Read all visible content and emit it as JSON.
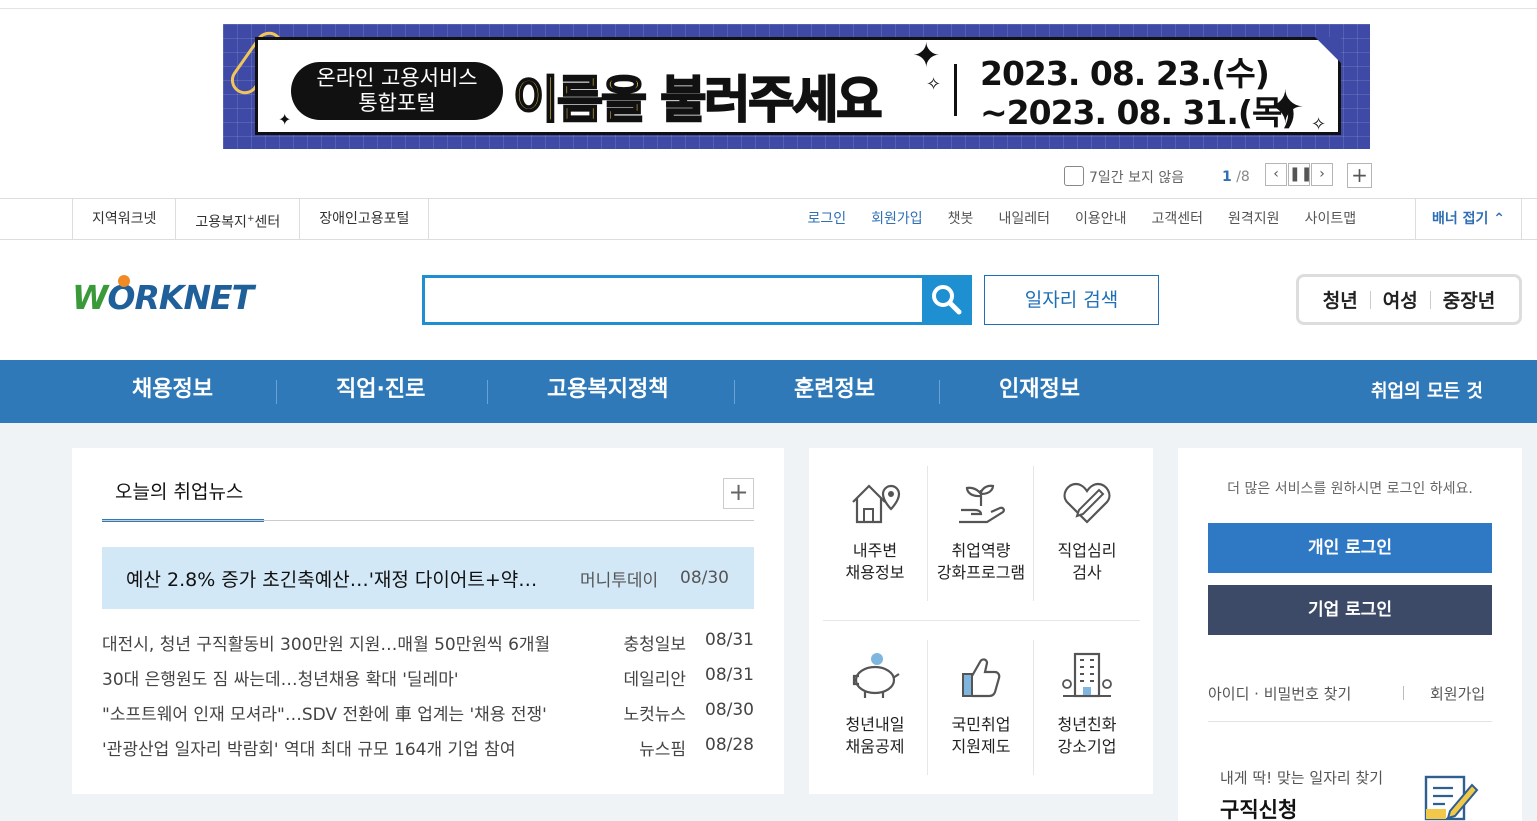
{
  "banner": {
    "pill_line1": "온라인 고용서비스",
    "pill_line2": "통합포털",
    "title_highlight": "이름을",
    "title_rest": " 불러주세요",
    "date_from": "2023. 08. 23.(수)",
    "date_to": "~2023. 08.  31.(목)",
    "dismiss_label": "7일간 보지 않음",
    "counter_current": "1",
    "counter_total": "/8"
  },
  "util_left": [
    "지역워크넷",
    "고용복지",
    "센터",
    "장애인고용포털"
  ],
  "util_left_sup": "+",
  "util_right": [
    "로그인",
    "회원가입",
    "챗봇",
    "내일레터",
    "이용안내",
    "고객센터",
    "원격지원",
    "사이트맵"
  ],
  "fold_banner": "배너 접기",
  "logo": {
    "text": "ORKNET",
    "w": "W"
  },
  "search": {
    "value": "",
    "button_label": "일자리 검색"
  },
  "target_groups": [
    "청년",
    "여성",
    "중장년"
  ],
  "gnb": [
    "채용정보",
    "직업·진로",
    "고용복지정책",
    "훈련정보",
    "인재정보"
  ],
  "gnb_all": "취업의 모든 것",
  "news": {
    "tab": "오늘의 취업뉴스",
    "headline": {
      "title": "예산 2.8% 증가 초긴축예산…'재정 다이어트+약…",
      "source": "머니투데이",
      "date": "08/30"
    },
    "items": [
      {
        "title": "대전시, 청년 구직활동비 300만원 지원…매월 50만원씩 6개월",
        "source": "충청일보",
        "date": "08/31"
      },
      {
        "title": "30대 은행원도 짐 싸는데…청년채용 확대 '딜레마'",
        "source": "데일리안",
        "date": "08/31"
      },
      {
        "title": "\"소프트웨어 인재 모셔라\"…SDV 전환에 車 업계는 '채용 전쟁'",
        "source": "노컷뉴스",
        "date": "08/30"
      },
      {
        "title": "'관광산업 일자리 박람회' 역대 최대 규모 164개 기업 참여",
        "source": "뉴스핌",
        "date": "08/28"
      }
    ]
  },
  "services": [
    {
      "line1": "내주변",
      "line2": "채용정보",
      "icon": "house-location-icon"
    },
    {
      "line1": "취업역량",
      "line2": "강화프로그램",
      "icon": "sprout-hand-icon"
    },
    {
      "line1": "직업심리",
      "line2": "검사",
      "icon": "heart-pen-icon"
    },
    {
      "line1": "청년내일",
      "line2": "채움공제",
      "icon": "piggy-bank-icon"
    },
    {
      "line1": "국민취업",
      "line2": "지원제도",
      "icon": "thumbs-up-icon"
    },
    {
      "line1": "청년친화",
      "line2": "강소기업",
      "icon": "building-icon"
    }
  ],
  "login": {
    "hint": "더 많은 서비스를 원하시면 로그인 하세요.",
    "personal": "개인 로그인",
    "company": "기업 로그인",
    "find": "아이디 · 비밀번호 찾기",
    "join": "회원가입",
    "apply_small": "내게 딱! 맞는 일자리 찾기",
    "apply_big": "구직신청"
  }
}
